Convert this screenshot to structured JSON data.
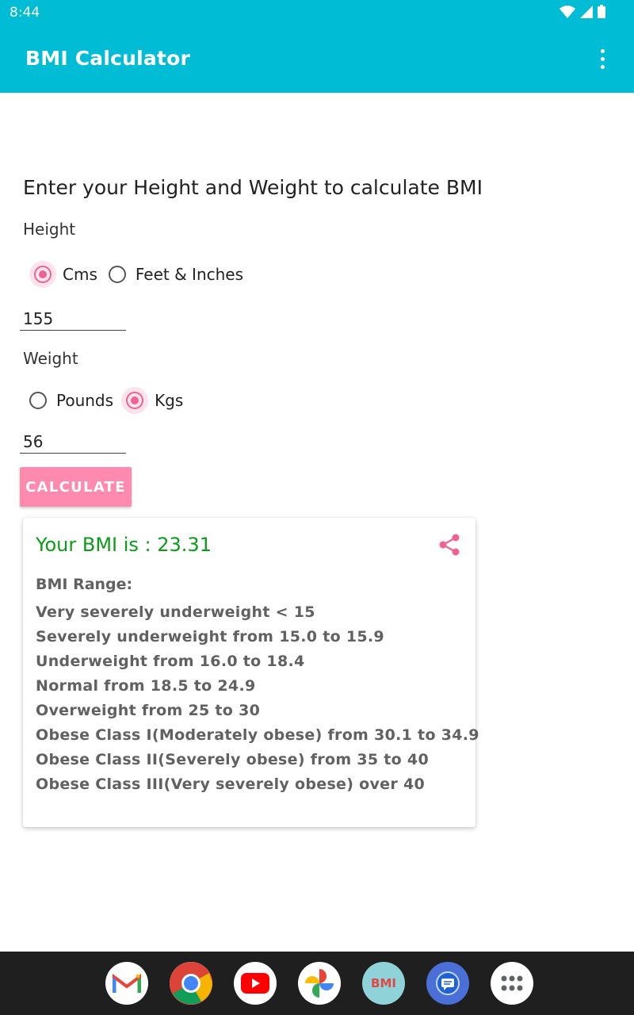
{
  "status_bar": {
    "time": "8:44"
  },
  "app_bar": {
    "title": "BMI Calculator"
  },
  "form": {
    "heading": "Enter your Height and Weight to calculate BMI",
    "height_label": "Height",
    "height_units": [
      {
        "label": "Cms",
        "checked": true
      },
      {
        "label": "Feet & Inches",
        "checked": false
      }
    ],
    "height_value": "155",
    "weight_label": "Weight",
    "weight_units": [
      {
        "label": "Pounds",
        "checked": false
      },
      {
        "label": "Kgs",
        "checked": true
      }
    ],
    "weight_value": "56",
    "calculate_label": "CALCULATE"
  },
  "result": {
    "bmi_text": "Your BMI is : 23.31",
    "range_title": "BMI Range:",
    "ranges": [
      "Very severely underweight < 15",
      "Severely underweight from 15.0 to 15.9",
      "Underweight from 16.0 to 18.4",
      "Normal from 18.5 to 24.9",
      "Overweight from 25 to 30",
      "Obese Class I(Moderately obese) from 30.1 to 34.9",
      "Obese Class II(Severely obese) from 35 to 40",
      "Obese Class III(Very severely obese) over 40"
    ]
  },
  "dock": {
    "apps": [
      "gmail-icon",
      "chrome-icon",
      "youtube-icon",
      "photos-icon",
      "bmi-app-icon",
      "messages-icon",
      "app-drawer-icon"
    ],
    "bmi_app_text": "BMI"
  },
  "colors": {
    "primary": "#00bcd4",
    "accent": "#f06292",
    "button": "#ff8ab0",
    "bmi_result": "#0c9b18",
    "range_text": "#616161"
  }
}
